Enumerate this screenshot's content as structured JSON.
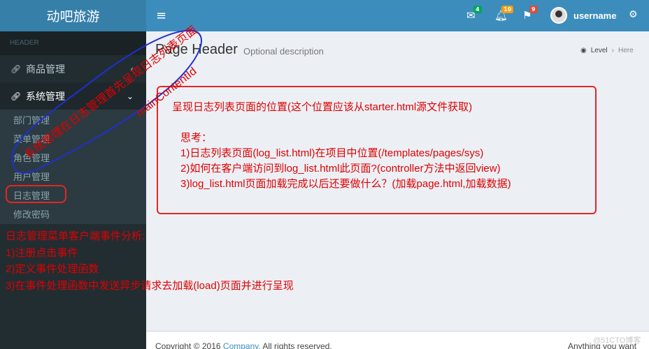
{
  "header": {
    "logo": "动吧旅游",
    "toggle_icon": "≡",
    "mail_count": "4",
    "bell_count": "10",
    "flag_count": "9",
    "username": "username",
    "colors": {
      "mail_badge": "#00a65a",
      "bell_badge": "#f39c12",
      "flag_badge": "#dd4b39"
    }
  },
  "sidebar": {
    "header": "HEADER",
    "menus": [
      {
        "label": "商品管理",
        "icon": "link-icon"
      },
      {
        "label": "系统管理",
        "icon": "link-icon"
      }
    ],
    "submenu": [
      "部门管理",
      "菜单管理",
      "角色管理",
      "用户管理",
      "日志管理",
      "修改密码"
    ]
  },
  "content": {
    "title": "Page Header",
    "description": "Optional description",
    "breadcrumb": {
      "level": "Level",
      "here": "Here"
    }
  },
  "annotations": {
    "box_lines": [
      "呈现日志列表页面的位置(这个位置应该从starter.html源文件获取)",
      "思考：",
      "1)日志列表页面(log_list.html)在项目中位置(/templates/pages/sys)",
      "2)如何在客户端访问到log_list.html此页面?(controller方法中返回view)",
      "3)log_list.html页面加载完成以后还要做什么？(加载page.html,加载数据)"
    ],
    "diagonal_text": "系统管理在日志管理首先呈现日志列表页面",
    "main_content_id": "mainContentId",
    "analysis": [
      "日志管理菜单客户端事件分析:",
      "1)注册点击事件",
      "2)定义事件处理函数",
      "3)在事件处理函数中发送异步请求去加载(load)页面并进行呈现"
    ]
  },
  "footer": {
    "copyright_prefix": "Copyright © 2016",
    "company": "Company.",
    "rights": "All rights reserved.",
    "right_text": "Anything you want"
  },
  "watermark": "@51CTO博客"
}
